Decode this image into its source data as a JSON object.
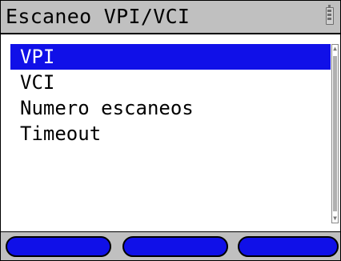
{
  "window": {
    "title": "Escaneo VPI/VCI",
    "status_icon": "battery-icon"
  },
  "menu": {
    "items": [
      {
        "label": "VPI",
        "selected": true
      },
      {
        "label": "VCI",
        "selected": false
      },
      {
        "label": "Numero escaneos",
        "selected": false
      },
      {
        "label": "Timeout",
        "selected": false
      }
    ]
  },
  "softkeys": [
    {
      "label": ""
    },
    {
      "label": ""
    },
    {
      "label": ""
    }
  ],
  "colors": {
    "selection": "#1010e8",
    "title_background": "#c0c0c0",
    "softkey": "#1010e8"
  }
}
